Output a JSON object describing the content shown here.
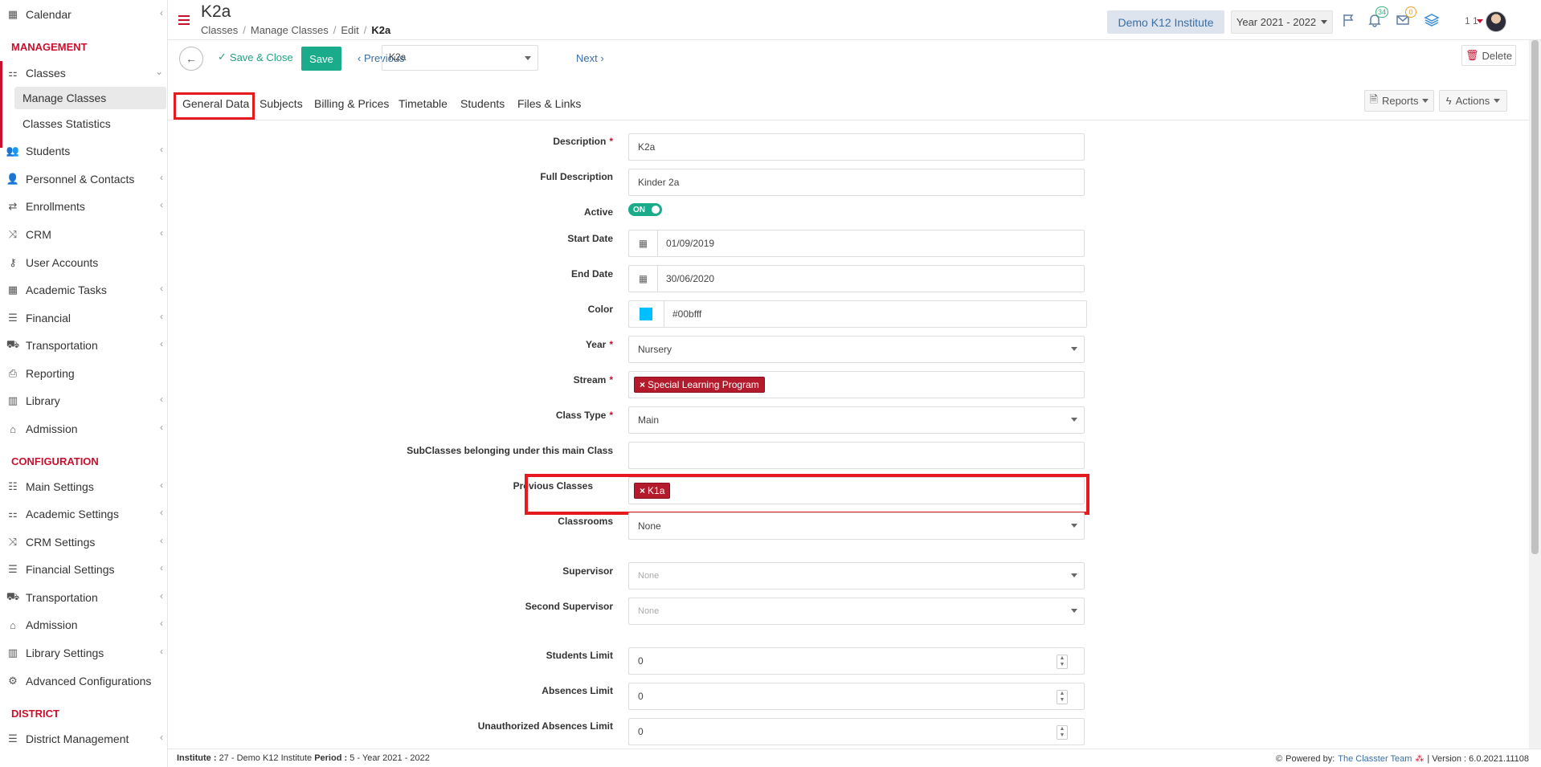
{
  "sidebar": {
    "calendar": "Calendar",
    "management_head": "MANAGEMENT",
    "classes": "Classes",
    "manage_classes": "Manage Classes",
    "classes_statistics": "Classes Statistics",
    "students": "Students",
    "personnel": "Personnel & Contacts",
    "enrollments": "Enrollments",
    "crm": "CRM",
    "user_accounts": "User Accounts",
    "academic_tasks": "Academic Tasks",
    "financial": "Financial",
    "transportation": "Transportation",
    "reporting": "Reporting",
    "library": "Library",
    "admission": "Admission",
    "configuration_head": "CONFIGURATION",
    "main_settings": "Main Settings",
    "academic_settings": "Academic Settings",
    "crm_settings": "CRM Settings",
    "financial_settings": "Financial Settings",
    "transportation2": "Transportation",
    "admission2": "Admission",
    "library_settings": "Library Settings",
    "advanced_configurations": "Advanced Configurations",
    "district_head": "DISTRICT",
    "district_management": "District Management"
  },
  "header": {
    "title": "K2a",
    "breadcrumb": [
      "Classes",
      "Manage Classes",
      "Edit",
      "K2a"
    ],
    "institute": "Demo K12 Institute",
    "year": "Year 2021 - 2022",
    "notifications_count": "34",
    "messages_count": "0",
    "user_label": "1 1"
  },
  "toolbar": {
    "save_close": "Save & Close",
    "save": "Save",
    "previous": "Previous",
    "current_class": "K2a",
    "next": "Next",
    "delete": "Delete"
  },
  "tabs": {
    "general_data": "General Data",
    "subjects": "Subjects",
    "billing": "Billing & Prices",
    "timetable": "Timetable",
    "students": "Students",
    "files": "Files & Links",
    "reports": "Reports",
    "actions": "Actions"
  },
  "form": {
    "description_label": "Description",
    "description": "K2a",
    "full_description_label": "Full Description",
    "full_description": "Kinder 2a",
    "active_label": "Active",
    "active_value": "ON",
    "start_date_label": "Start Date",
    "start_date": "01/09/2019",
    "end_date_label": "End Date",
    "end_date": "30/06/2020",
    "color_label": "Color",
    "color": "#00bfff",
    "year_label": "Year",
    "year": "Nursery",
    "stream_label": "Stream",
    "stream_chip": "Special Learning Program",
    "class_type_label": "Class Type",
    "class_type": "Main",
    "subclasses_label": "SubClasses belonging under this main Class",
    "previous_classes_label": "Previous Classes",
    "previous_classes_chip": "K1a",
    "classrooms_label": "Classrooms",
    "classrooms": "None",
    "supervisor_label": "Supervisor",
    "supervisor": "None",
    "second_supervisor_label": "Second Supervisor",
    "second_supervisor": "None",
    "students_limit_label": "Students Limit",
    "students_limit": "0",
    "absences_limit_label": "Absences Limit",
    "absences_limit": "0",
    "unauth_absences_label": "Unauthorized Absences Limit",
    "unauth_absences": "0"
  },
  "footer": {
    "institute_label": "Institute :",
    "institute_value": "27 - Demo K12 Institute",
    "period_label": "Period :",
    "period_value": "5 - Year 2021 - 2022",
    "powered_by": "Powered by:",
    "team": "The Classter Team",
    "version": "| Version : 6.0.2021.11108"
  },
  "colors": {
    "accent": "#c8102e",
    "primary": "#1aab8a",
    "highlight": "#e5191e",
    "chip": "#b31b2c"
  }
}
